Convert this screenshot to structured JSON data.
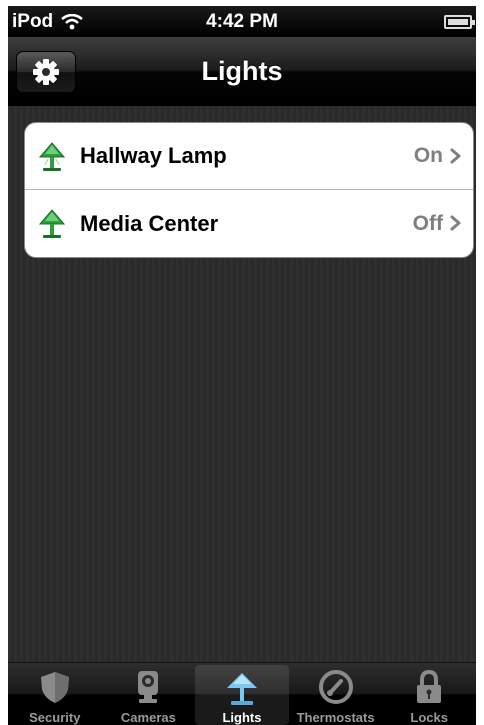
{
  "status_bar": {
    "carrier": "iPod",
    "time": "4:42 PM"
  },
  "nav": {
    "title": "Lights",
    "settings_icon": "gear-icon"
  },
  "lights": [
    {
      "name": "Hallway Lamp",
      "state": "On"
    },
    {
      "name": "Media Center",
      "state": "Off"
    }
  ],
  "tabs": [
    {
      "label": "Security",
      "icon": "shield-icon",
      "selected": false
    },
    {
      "label": "Cameras",
      "icon": "camera-icon",
      "selected": false
    },
    {
      "label": "Lights",
      "icon": "lamp-icon",
      "selected": true
    },
    {
      "label": "Thermostats",
      "icon": "thermostat-icon",
      "selected": false
    },
    {
      "label": "Locks",
      "icon": "lock-icon",
      "selected": false
    }
  ],
  "colors": {
    "lamp_green": "#2e9e3a",
    "selected_tab_icon": "#7ec8f0",
    "value_gray": "#7f7f7f"
  }
}
